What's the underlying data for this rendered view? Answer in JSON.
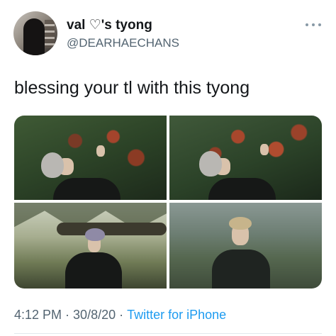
{
  "author": {
    "name": "val ♡'s tyong",
    "handle": "@DEARHAECHANS"
  },
  "tweet": {
    "text": "blessing your tl with this tyong"
  },
  "media": {
    "count": 4
  },
  "footer": {
    "time": "4:12 PM",
    "separator": "·",
    "date": "30/8/20",
    "source": "Twitter for iPhone"
  },
  "colors": {
    "link": "#1d9bf0",
    "secondary_text": "#536471",
    "primary_text": "#14171a"
  },
  "icons": {
    "more": "more-dots-icon"
  }
}
